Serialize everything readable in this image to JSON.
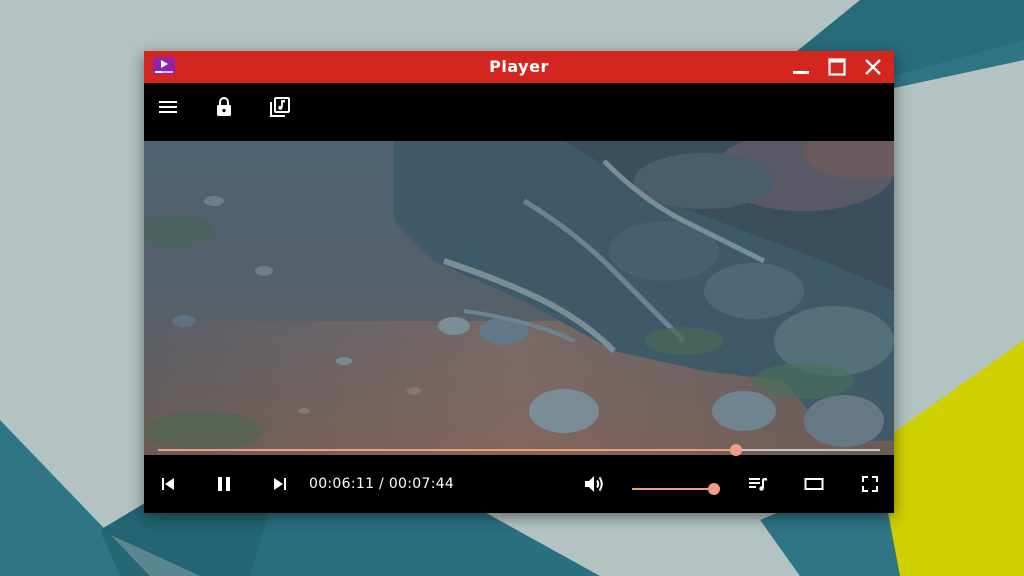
{
  "window": {
    "title": "Player"
  },
  "titlebar": {
    "app_icon": "media-player-icon",
    "buttons": [
      "minimize-icon",
      "maximize-icon",
      "close-icon"
    ]
  },
  "toolbar": {
    "icons": [
      "menu-icon",
      "lock-icon",
      "music-library-icon"
    ]
  },
  "playback": {
    "position": "00:06:11",
    "separator": "/",
    "duration": "00:07:44",
    "progress": 0.8
  },
  "controls": {
    "icons": [
      "skip-previous-icon",
      "pause-icon",
      "skip-next-icon",
      "volume-icon",
      "playlist-icon",
      "aspect-ratio-icon",
      "fullscreen-icon"
    ],
    "volume_level": 1.0
  },
  "colors": {
    "titlebar": "#d3261f",
    "accent": "#f29b85",
    "desktop": "#b3c3c2",
    "desktop_teal": "#2f7585",
    "desktop_yellow": "#cfd000"
  }
}
